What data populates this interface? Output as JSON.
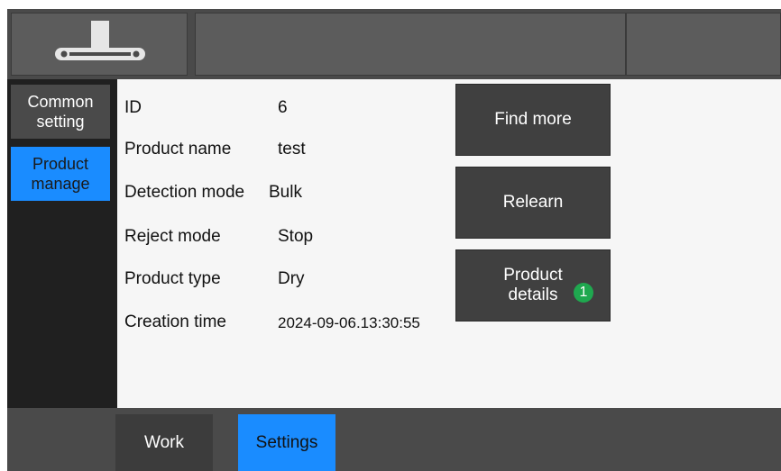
{
  "colors": {
    "accent": "#1a8cff",
    "badge": "#1fa84f",
    "panel": "#404040"
  },
  "header": {
    "logo_icon": "conveyor-icon"
  },
  "sidebar": {
    "items": [
      {
        "label": "Common\nsetting"
      },
      {
        "label": "Product\nmanage"
      }
    ]
  },
  "product": {
    "rows": [
      {
        "label": "ID",
        "value": "6"
      },
      {
        "label": "Product name",
        "value": "test"
      },
      {
        "label": "Detection mode",
        "value": "Bulk"
      },
      {
        "label": "Reject mode",
        "value": "Stop"
      },
      {
        "label": "Product type",
        "value": "Dry"
      },
      {
        "label": "Creation time",
        "value": "2024-09-06.13:30:55"
      }
    ]
  },
  "actions": {
    "find_more": "Find more",
    "relearn": "Relearn",
    "product_details": "Product\ndetails",
    "details_badge": "1"
  },
  "bottom_nav": {
    "tabs": [
      {
        "label": "Work"
      },
      {
        "label": "Settings"
      }
    ]
  }
}
